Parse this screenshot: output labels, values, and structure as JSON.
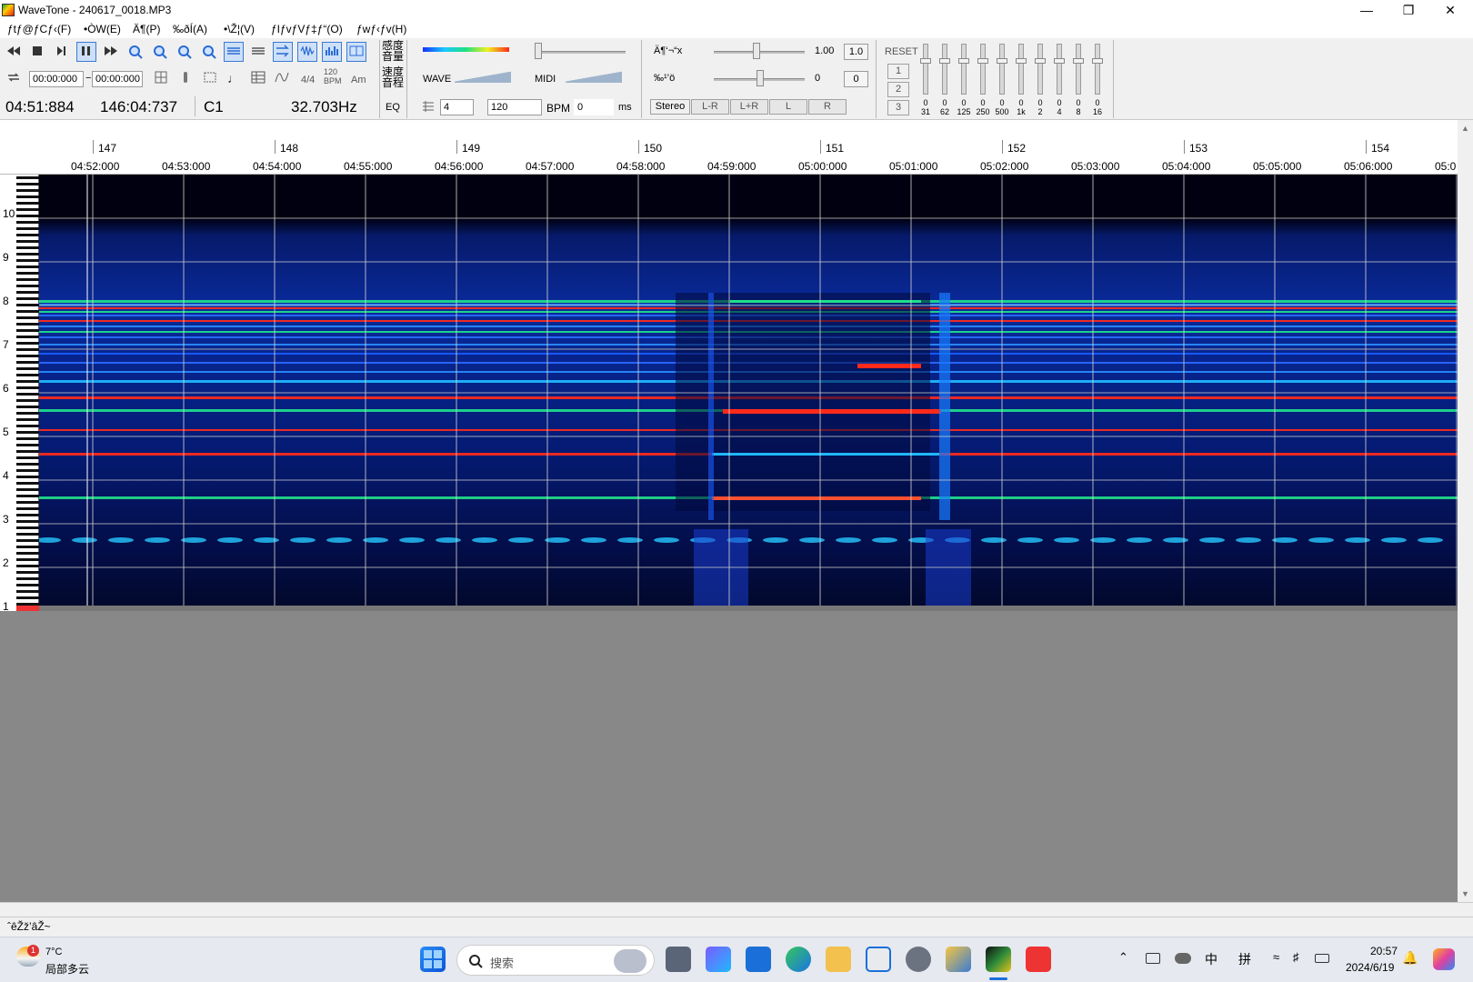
{
  "window": {
    "title": "WaveTone - 240617_0018.MP3"
  },
  "menu": [
    "ƒtƒ@ƒCƒ‹(F)",
    "•ÒW(E)",
    "Ä¶(P)",
    "‰ðÍ(A)",
    "•\\Ž¦(V)",
    "ƒIƒvƒVƒ‡ƒ“(O)",
    "ƒwƒ‹ƒv(H)"
  ],
  "toolbar": {
    "loop_start": "00:00:000",
    "loop_sep": "−",
    "loop_end": "00:00:000",
    "sig": "4/4",
    "bpm_badge_top": "120",
    "bpm_badge_bottom": "BPM",
    "key": "Am",
    "sens_label_1": "感度",
    "sens_label_2": "音量",
    "speed_label_1": "速度",
    "speed_label_2": "音程",
    "wave_label": "WAVE",
    "midi_label": "MIDI",
    "speed_symbol": "Ä¶‘¬“x",
    "speed_value": "1.00",
    "speed_box": "1.0",
    "pitch_symbol": "‰¹’ö",
    "pitch_value": "0",
    "pitch_box": "0",
    "eq_label": "EQ",
    "beat_value": "4",
    "tempo_value": "120",
    "bpm_label": "BPM",
    "offset_value": "0",
    "ms_label": "ms",
    "stereo_label": "Stereo",
    "channel_buttons": [
      "L-R",
      "L+R",
      "L",
      "R"
    ],
    "reset_label": "RESET",
    "preset_buttons": [
      "1",
      "2",
      "3"
    ],
    "eq_values": [
      "0",
      "0",
      "0",
      "0",
      "0",
      "0",
      "0",
      "0",
      "0",
      "0"
    ],
    "eq_freqs": [
      "31",
      "62",
      "125",
      "250",
      "500",
      "1k",
      "2",
      "4",
      "8",
      "16"
    ]
  },
  "status": {
    "position": "04:51:884",
    "total": "146:04:737",
    "note": "C1",
    "freq": "32.703Hz"
  },
  "ruler": {
    "measures": [
      "147",
      "148",
      "149",
      "150",
      "151",
      "152",
      "153",
      "154"
    ],
    "times": [
      "04:52:000",
      "04:53:000",
      "04:54:000",
      "04:55:000",
      "04:56:000",
      "04:57:000",
      "04:58:000",
      "04:59:000",
      "05:00:000",
      "05:01:000",
      "05:02:000",
      "05:03:000",
      "05:04:000",
      "05:05:000",
      "05:06:000",
      "05:0"
    ]
  },
  "octaves": [
    "10",
    "9",
    "8",
    "7",
    "6",
    "5",
    "4",
    "3",
    "2",
    "1"
  ],
  "statusbar": {
    "text": "ˆêŽž’âŽ~"
  },
  "taskbar": {
    "weather_temp": "7°C",
    "weather_desc": "局部多云",
    "weather_badge": "1",
    "search_placeholder": "搜索",
    "ime_lang": "中",
    "ime_mode": "拼",
    "clock_time": "20:57",
    "clock_date": "2024/6/19"
  },
  "colors": {
    "spectro_bg": "#000018",
    "hot": "#ff2a1a",
    "warm": "#1fe08a",
    "cool": "#2a6bff",
    "accent": "#3a7bd5"
  }
}
